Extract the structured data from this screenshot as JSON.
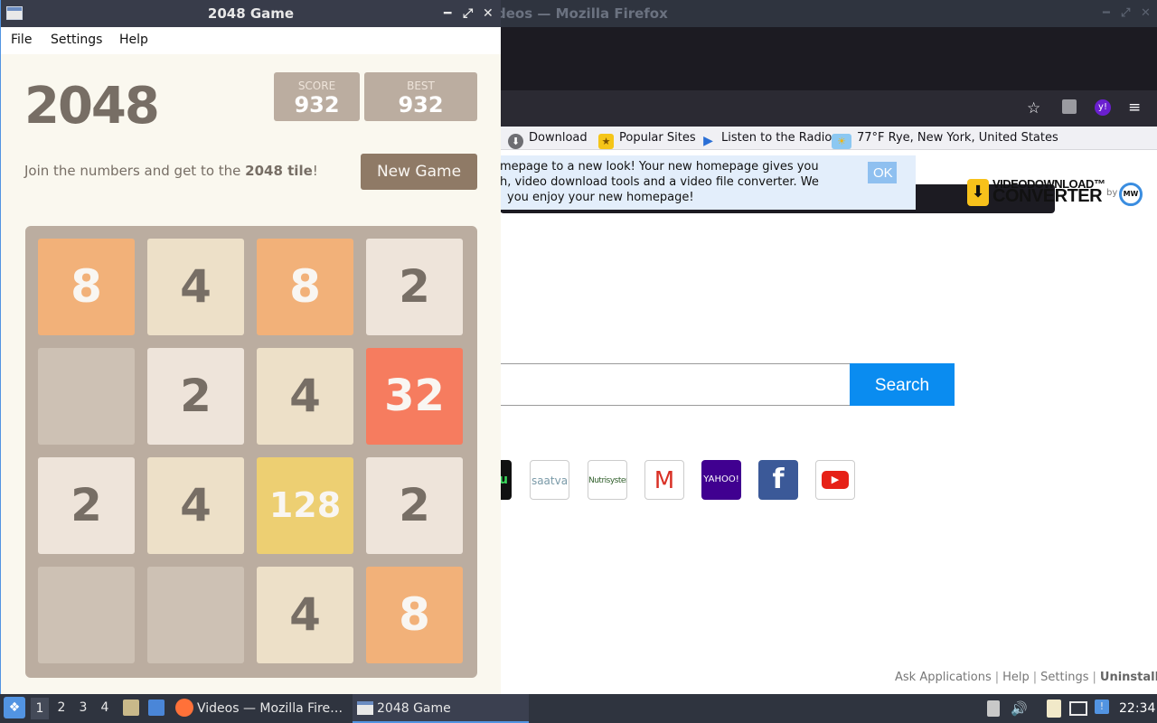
{
  "firefox": {
    "window_title": "Videos — Mozilla Firefox",
    "window_title_visible": "deos — Mozilla Firefox",
    "bookmarks": [
      {
        "label": "Download",
        "icon": "download-icon"
      },
      {
        "label": "Popular Sites",
        "icon": "star-icon"
      },
      {
        "label": "Listen to the Radio",
        "icon": "play-icon"
      },
      {
        "label": "77°F Rye, New York, United States",
        "icon": "weather-icon"
      }
    ],
    "notice": {
      "line1": "mepage to a new look! Your new homepage gives you",
      "line2": "h, video download tools and a video file converter. We",
      "line3": "you enjoy your new homepage!",
      "ok_label": "OK"
    },
    "logo": {
      "line1": "VIDEODOWNLOAD™",
      "line2": "CONVERTER",
      "by": "by",
      "mw": "MW"
    },
    "search_button": "Search",
    "shortcuts": [
      "hulu",
      "saatva",
      "Nutrisystem",
      "Gmail",
      "YAHOO!",
      "Facebook",
      "YouTube"
    ],
    "footer": {
      "ask": "Ask Applications",
      "help": "Help",
      "settings": "Settings",
      "uninstall": "Uninstall"
    }
  },
  "game": {
    "window_title": "2048 Game",
    "menu": [
      "File",
      "Settings",
      "Help"
    ],
    "heading": "2048",
    "score_label": "SCORE",
    "score": "932",
    "best_label": "BEST",
    "best": "932",
    "intro_text": "Join the numbers and get to the ",
    "intro_bold": "2048 tile",
    "intro_end": "!",
    "new_game_label": "New Game",
    "board": [
      [
        8,
        4,
        8,
        2
      ],
      [
        0,
        2,
        4,
        32
      ],
      [
        2,
        4,
        128,
        2
      ],
      [
        0,
        0,
        4,
        8
      ]
    ]
  },
  "taskbar": {
    "workspaces": [
      "1",
      "2",
      "3",
      "4"
    ],
    "tasks": [
      {
        "label": "Videos — Mozilla Fire…",
        "icon": "firefox-icon"
      },
      {
        "label": "2048 Game",
        "icon": "window-icon"
      }
    ],
    "clock": "22:34"
  }
}
